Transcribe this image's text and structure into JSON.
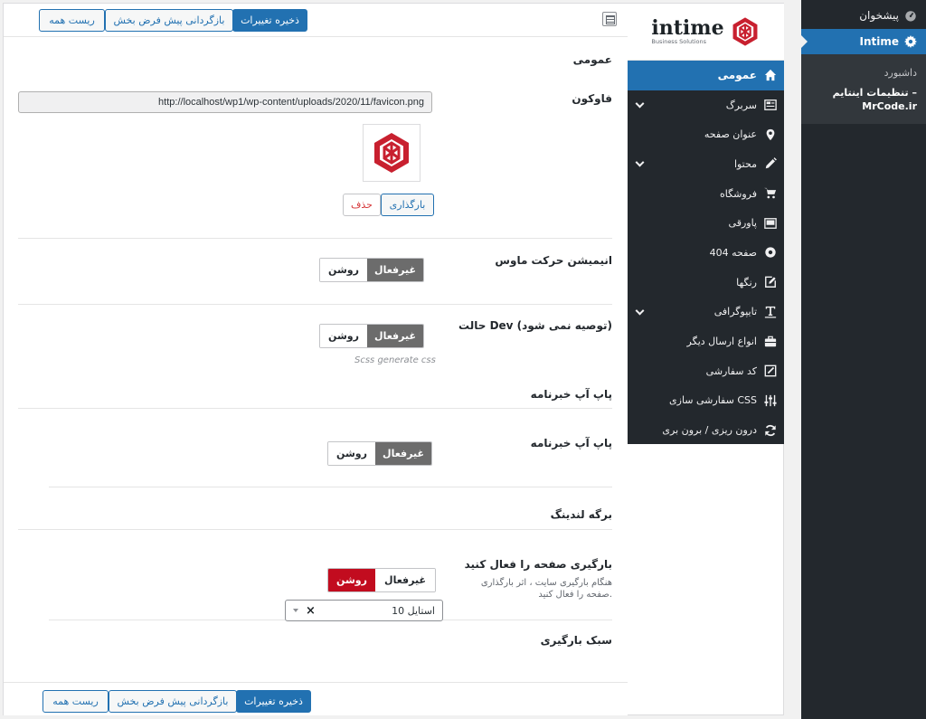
{
  "wp_sidebar": {
    "dashboard_label": "پیشخوان",
    "intime_label": "Intime",
    "sub_items": [
      {
        "label": "داشبورد"
      },
      {
        "label": "تنظیمات اینتایم – MrCode.ir"
      }
    ]
  },
  "toolbar": {
    "save_label": "ذخیره تغییرات",
    "reset_section_label": "بازگردانی پیش فرض بخش",
    "reset_all_label": "ریست همه"
  },
  "logo": {
    "name": "intime",
    "subtitle": "Business Solutions"
  },
  "nav": {
    "items": [
      {
        "label": "عمومی",
        "icon": "home-icon",
        "active": true
      },
      {
        "label": "سربرگ",
        "icon": "header-icon",
        "has_children": true
      },
      {
        "label": "عنوان صفحه",
        "icon": "map-pin-icon"
      },
      {
        "label": "محتوا",
        "icon": "pencil-icon",
        "has_children": true
      },
      {
        "label": "فروشگاه",
        "icon": "cart-icon"
      },
      {
        "label": "پاورقی",
        "icon": "footer-icon"
      },
      {
        "label": "صفحه 404",
        "icon": "gear-icon"
      },
      {
        "label": "رنگها",
        "icon": "edit-icon"
      },
      {
        "label": "تایپوگرافی",
        "icon": "text-icon",
        "has_children": true
      },
      {
        "label": "انواع ارسال دیگر",
        "icon": "briefcase-icon"
      },
      {
        "label": "کد سفارشی",
        "icon": "external-edit-icon"
      },
      {
        "label": "سفارشی سازی CSS",
        "icon": "sliders-icon"
      },
      {
        "label": "درون ریزی / برون بری",
        "icon": "refresh-icon"
      }
    ]
  },
  "general": {
    "section_title": "عمومی",
    "favicon": {
      "label": "فاوکون",
      "url": "http://localhost/wp1/wp-content/uploads/2020/11/favicon.png",
      "upload_label": "بارگذاری",
      "delete_label": "حذف"
    },
    "mouse_animation": {
      "label": "انیمیشن حرکت ماوس",
      "off_label": "غیرفعال",
      "on_label": "روشن"
    },
    "dev_mode": {
      "label": "حالت Dev (توصیه نمی شود)",
      "off_label": "غیرفعال",
      "on_label": "روشن",
      "hint": "Scss generate css"
    }
  },
  "newsletter": {
    "section_title": "پاپ آپ خبرنامه",
    "field": {
      "label": "پاپ آپ خبرنامه",
      "off_label": "غیرفعال",
      "on_label": "روشن"
    }
  },
  "landing": {
    "section_title": "برگه لندینگ",
    "preloader": {
      "label": "بارگیری صفحه را فعال کنید",
      "description": "هنگام بارگیری سایت ، اثر بارگذاری صفحه را فعال کنید.",
      "off_label": "غیرفعال",
      "on_label": "روشن"
    },
    "preloader_style": {
      "label": "سبک بارگیری",
      "selected": "استایل 10"
    }
  },
  "colors": {
    "accent": "#2271b1",
    "danger": "#c20c1f",
    "dark": "#23282d"
  }
}
